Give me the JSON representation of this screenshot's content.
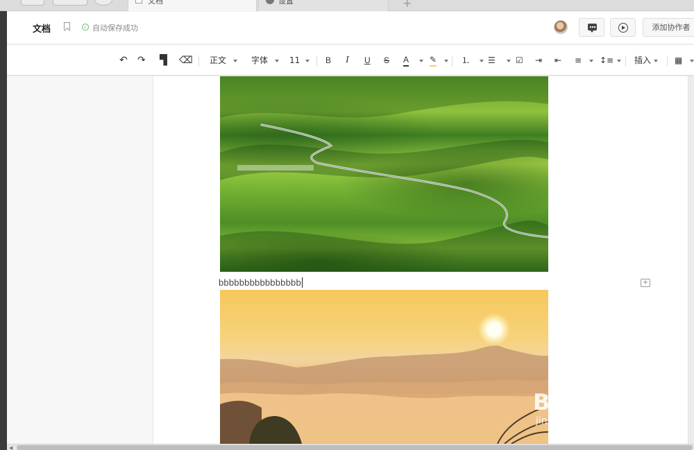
{
  "tabs": [
    {
      "label": "文档",
      "active": true
    },
    {
      "label": "设置",
      "active": false
    }
  ],
  "header": {
    "title": "文档",
    "save_status": "自动保存成功",
    "collab_label": "添加协作者"
  },
  "toolbar": {
    "style_label": "正文",
    "font_label": "字体",
    "size_label": "11",
    "bold": "B",
    "italic": "I",
    "underline": "U",
    "strike": "S",
    "font_color": "A",
    "insert_label": "插入"
  },
  "document": {
    "caption": "bbbbbbbbbbbbbbbb"
  },
  "watermark": {
    "brand": "Baidu经验",
    "url": "jingyan.baidu.com"
  },
  "colors": {
    "accent_green": "#6bb36b",
    "highlight_yellow": "#f3d25a"
  }
}
